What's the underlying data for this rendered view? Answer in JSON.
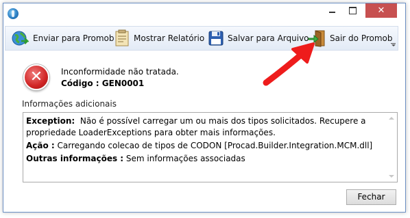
{
  "window": {
    "accent_color": "#c75050",
    "close_glyph": "✕"
  },
  "toolbar": {
    "items": [
      {
        "label": "Enviar para Promob",
        "icon": "globe-send-icon"
      },
      {
        "label": "Mostrar Relatório",
        "icon": "report-icon"
      },
      {
        "label": "Salvar para Arquivo",
        "icon": "floppy-disk-icon"
      },
      {
        "label": "Sair do Promob",
        "icon": "exit-door-icon"
      }
    ]
  },
  "error": {
    "icon": "error-icon",
    "glyph": "✕",
    "message": "Inconformidade não tratada.",
    "code_label": "Código :",
    "code_value": "GEN0001"
  },
  "details": {
    "section_label": "Informações adicionais",
    "exception_label": "Exception:",
    "exception_text": "Não é possível carregar um ou mais dos tipos solicitados. Recupere a propriedade LoaderExceptions para obter mais informações.",
    "action_label": "Ação :",
    "action_text": "Carregando colecao de tipos de CODON [Procad.Builder.Integration.MCM.dll]",
    "other_label": "Outras informações :",
    "other_text": "Sem informações associadas"
  },
  "buttons": {
    "close_label": "Fechar"
  },
  "annotation": {
    "arrow_color": "#ee1c1c"
  }
}
